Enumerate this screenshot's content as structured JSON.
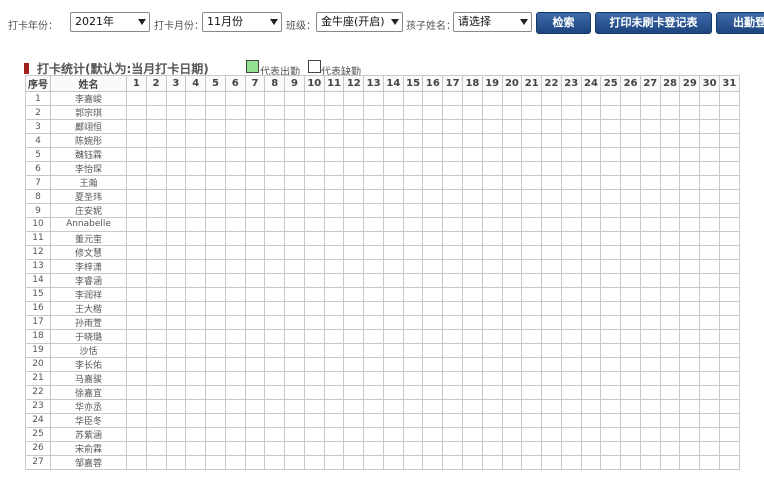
{
  "toolbar": {
    "year_label": "打卡年份：",
    "year_value": "2021年",
    "month_label": "打卡月份：",
    "month_value": "11月份",
    "class_label": "班级：",
    "class_value": "金牛座(开启)",
    "child_label": "孩子姓名：",
    "child_value": "请选择",
    "search_button": "检索",
    "print_button": "打印未刷卡登记表",
    "attendance_button": "出勤登"
  },
  "section": {
    "title": "打卡统计(默认为:当月打卡日期)",
    "legend_present": "代表出勤",
    "legend_absent": "代表缺勤",
    "present_color": "#90e090",
    "absent_color": "#ffffff"
  },
  "table": {
    "col_index": "序号",
    "col_name": "姓名",
    "days": [
      "1",
      "2",
      "3",
      "4",
      "5",
      "6",
      "7",
      "8",
      "9",
      "10",
      "11",
      "12",
      "13",
      "14",
      "15",
      "16",
      "17",
      "18",
      "19",
      "20",
      "21",
      "22",
      "23",
      "24",
      "25",
      "26",
      "27",
      "28",
      "29",
      "30",
      "31"
    ],
    "rows": [
      {
        "no": "1",
        "name": "李嘉峻"
      },
      {
        "no": "2",
        "name": "郭宗琪"
      },
      {
        "no": "3",
        "name": "鄺翊恒"
      },
      {
        "no": "4",
        "name": "陈婉彤"
      },
      {
        "no": "5",
        "name": "魏钰霖"
      },
      {
        "no": "6",
        "name": "李怡琛"
      },
      {
        "no": "7",
        "name": "王瀚"
      },
      {
        "no": "8",
        "name": "夏圣玮"
      },
      {
        "no": "9",
        "name": "庄安妮"
      },
      {
        "no": "10",
        "name": "Annabelle"
      },
      {
        "no": "11",
        "name": "董元奎"
      },
      {
        "no": "12",
        "name": "修文慧"
      },
      {
        "no": "13",
        "name": "李梓潇"
      },
      {
        "no": "14",
        "name": "李睿涵"
      },
      {
        "no": "15",
        "name": "李润祥"
      },
      {
        "no": "16",
        "name": "王大楷"
      },
      {
        "no": "17",
        "name": "孙雨萱"
      },
      {
        "no": "18",
        "name": "于晓璐"
      },
      {
        "no": "19",
        "name": "沙恬"
      },
      {
        "no": "20",
        "name": "李长佑"
      },
      {
        "no": "21",
        "name": "马嘉骏"
      },
      {
        "no": "22",
        "name": "徐嘉宜"
      },
      {
        "no": "23",
        "name": "华亦丞"
      },
      {
        "no": "24",
        "name": "华臣冬"
      },
      {
        "no": "25",
        "name": "苏紫涵"
      },
      {
        "no": "26",
        "name": "宋俞霖"
      },
      {
        "no": "27",
        "name": "邹嘉蓉"
      }
    ]
  }
}
